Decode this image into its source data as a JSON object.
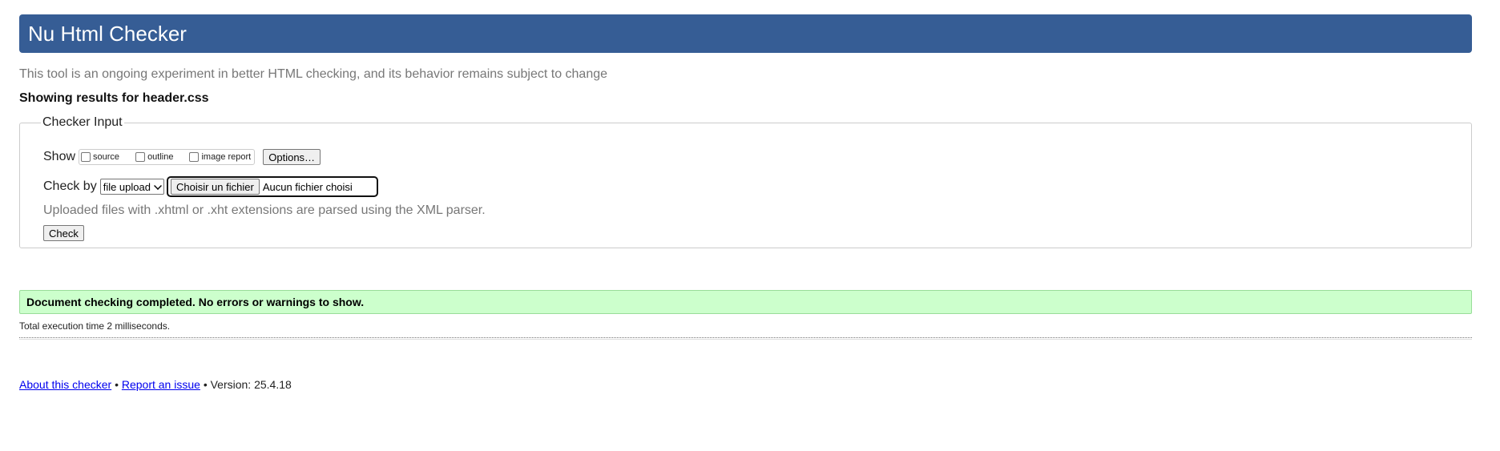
{
  "header": {
    "title": "Nu Html Checker",
    "subtitle": "This tool is an ongoing experiment in better HTML checking, and its behavior remains subject to change"
  },
  "results_heading": "Showing results for header.css",
  "checker_input": {
    "legend": "Checker Input",
    "show_label": "Show",
    "show_options": [
      {
        "label": "source",
        "checked": false
      },
      {
        "label": "outline",
        "checked": false
      },
      {
        "label": "image report",
        "checked": false
      }
    ],
    "options_button": "Options…",
    "check_by_label": "Check by",
    "check_by_selected": "file upload",
    "choose_file_button": "Choisir un fichier",
    "file_name": "Aucun fichier choisi",
    "note": "Uploaded files with .xhtml or .xht extensions are parsed using the XML parser.",
    "check_button": "Check"
  },
  "status": {
    "message": "Document checking completed. No errors or warnings to show.",
    "color": "#ccffcc"
  },
  "execution_time": "Total execution time 2 milliseconds.",
  "footer": {
    "about_link": "About this checker",
    "separator": "•",
    "report_link": "Report an issue",
    "version_text": "Version: 25.4.18"
  },
  "colors": {
    "header_bg": "#365d95",
    "link": "#0000ee"
  }
}
